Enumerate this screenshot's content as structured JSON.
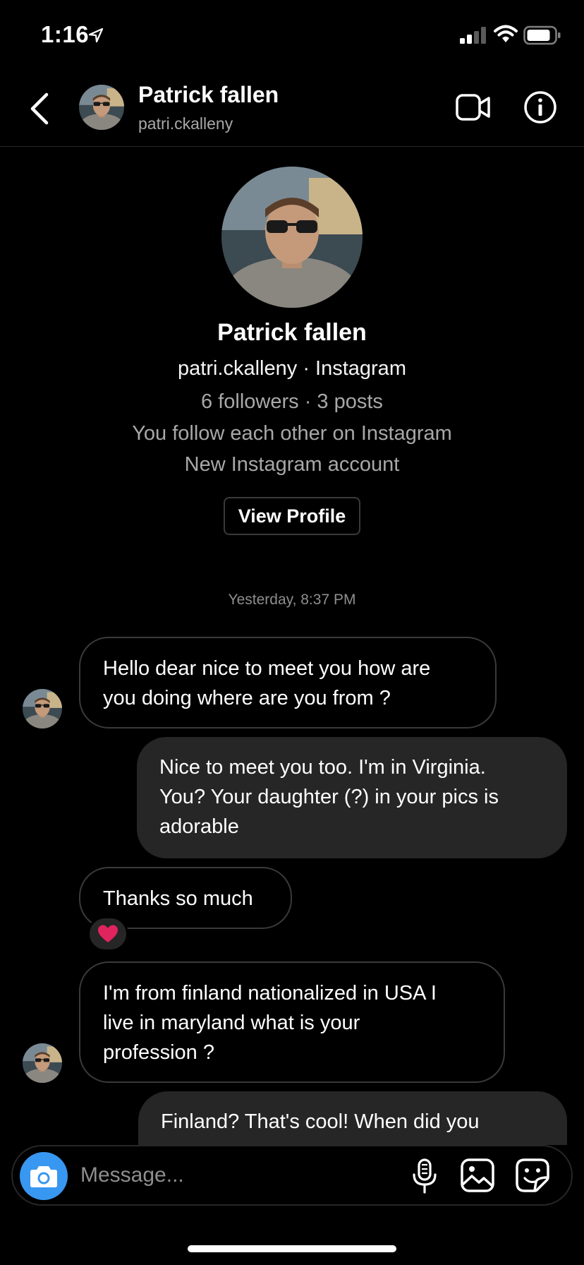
{
  "status_bar": {
    "time": "1:16"
  },
  "header": {
    "name": "Patrick fallen",
    "username": "patri.ckalleny"
  },
  "profile": {
    "name": "Patrick fallen",
    "handle_line": "patri.ckalleny · Instagram",
    "stats_line": "6 followers · 3 posts",
    "follow_line": "You follow each other on Instagram",
    "new_account_line": "New Instagram account",
    "view_profile_label": "View Profile"
  },
  "timestamp": "Yesterday, 8:37 PM",
  "messages": [
    {
      "sender": "them",
      "lines": [
        "Hello dear nice to meet you how are",
        "you doing where are you from ?"
      ]
    },
    {
      "sender": "me",
      "lines": [
        "Nice to meet you too. I'm in Virginia.",
        "You? Your daughter (?) in your pics is",
        "adorable"
      ]
    },
    {
      "sender": "them",
      "lines": [
        "Thanks so much"
      ],
      "reaction": "❤️"
    },
    {
      "sender": "them",
      "lines": [
        "I'm from finland nationalized in USA I",
        "live in maryland what is your",
        "profession ?"
      ]
    },
    {
      "sender": "me",
      "lines": [
        "Finland? That's cool! When did you"
      ]
    }
  ],
  "composer": {
    "placeholder": "Message..."
  },
  "icons": {
    "back": "chevron-left-icon",
    "video": "video-camera-icon",
    "info": "info-icon",
    "camera": "camera-icon",
    "mic": "microphone-icon",
    "gallery": "image-icon",
    "sticker": "sticker-icon",
    "reaction": "heart-icon"
  },
  "colors": {
    "background": "#000000",
    "outgoing_bubble": "#262626",
    "incoming_border": "#3a3a3a",
    "secondary_text": "#a8a8a8",
    "camera_button": "#3897f0",
    "heart": "#e0245e"
  }
}
